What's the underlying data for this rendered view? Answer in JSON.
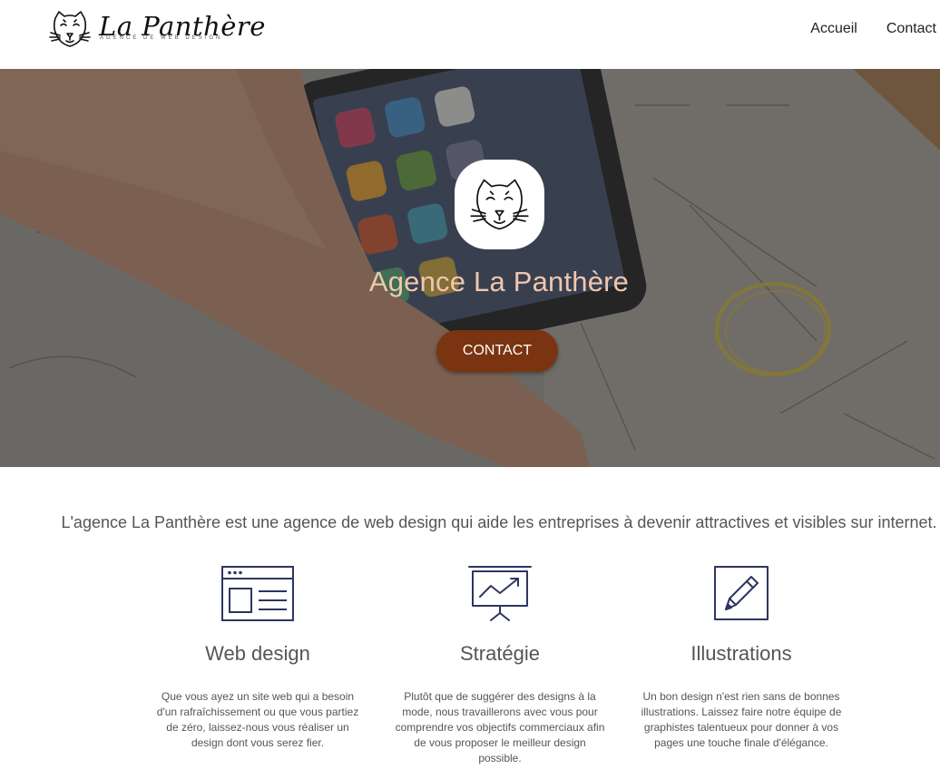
{
  "header": {
    "logo_name": "La Panthère",
    "logo_tagline": "AGENCE DE WEB DESIGN",
    "logo_icon": "panther-icon",
    "nav": [
      {
        "label": "Accueil"
      },
      {
        "label": "Contact"
      }
    ]
  },
  "hero": {
    "badge_icon": "panther-icon",
    "title": "Agence La Panthère",
    "cta_label": "CONTACT",
    "colors": {
      "title": "#f2c6ad",
      "cta": "#7a3411"
    }
  },
  "intro": {
    "text": "L'agence La Panthère est une agence de web design qui aide les entreprises à devenir attractives et visibles sur internet."
  },
  "services": [
    {
      "icon": "browser-window-icon",
      "title": "Web design",
      "text": "Que vous ayez un site web qui a besoin d'un rafraîchissement ou que vous partiez de zéro, laissez-nous vous réaliser un design dont vous serez fier."
    },
    {
      "icon": "presentation-chart-icon",
      "title": "Stratégie",
      "text": "Plutôt que de suggérer des designs à la mode, nous travaillerons avec vous pour comprendre vos objectifs commerciaux afin de vous proposer le meilleur design possible."
    },
    {
      "icon": "pencil-icon",
      "title": "Illustrations",
      "text": "Un bon design n'est rien sans de bonnes illustrations. Laissez faire notre équipe de graphistes talentueux pour donner à vos pages une touche finale d'élégance."
    }
  ],
  "colors": {
    "icon_stroke": "#2d3561",
    "text": "#555555"
  }
}
